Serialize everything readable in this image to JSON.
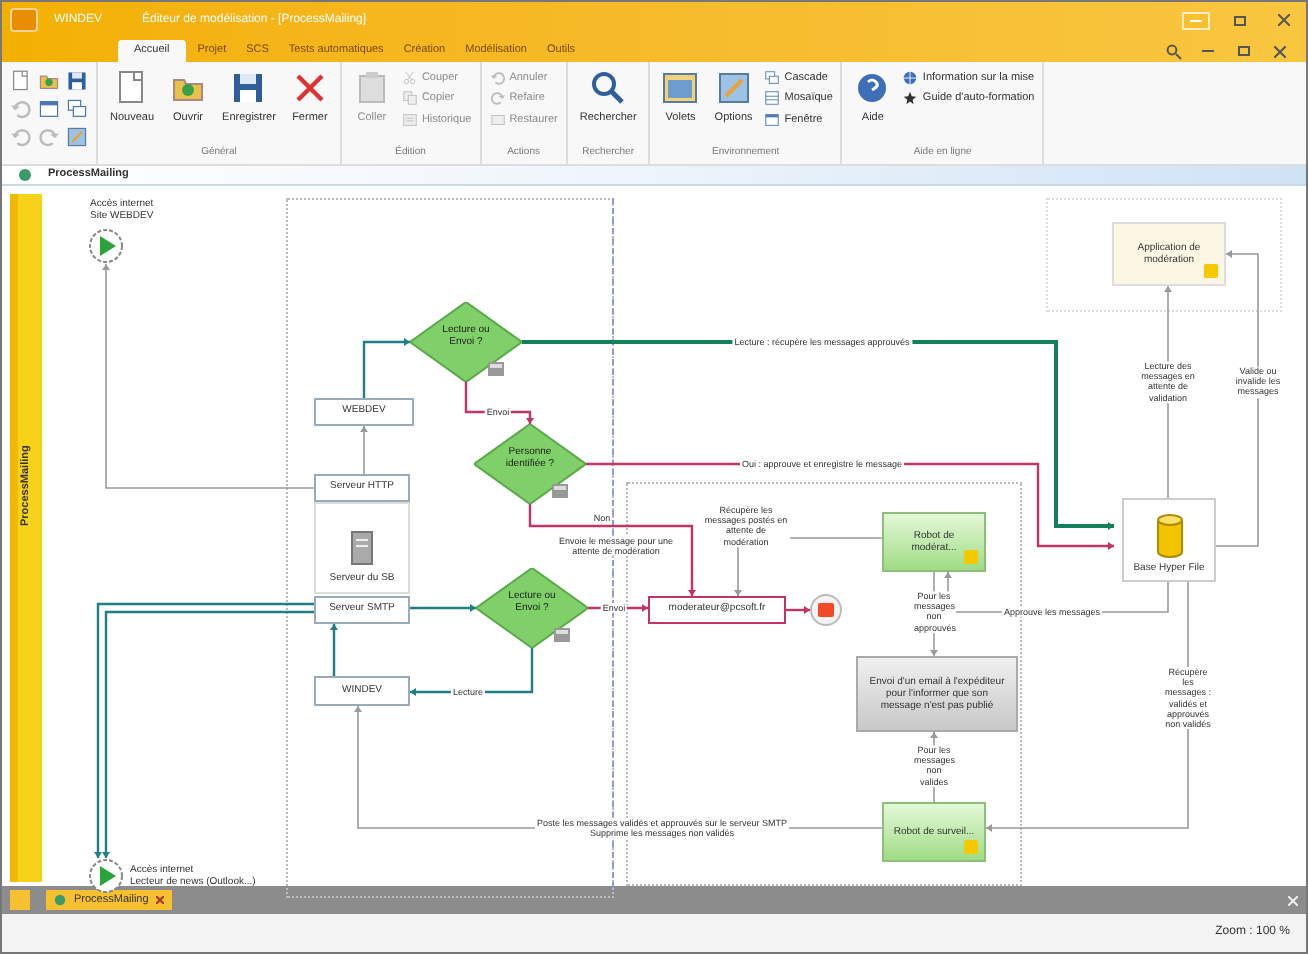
{
  "window": {
    "app": "WINDEV",
    "title": "Éditeur de modélisation - [ProcessMailing]"
  },
  "ribbon_tabs": [
    {
      "label": "Accueil",
      "selected": true
    },
    {
      "label": "Projet",
      "selected": false
    },
    {
      "label": "SCS",
      "selected": false
    },
    {
      "label": "Tests automatiques",
      "selected": false
    },
    {
      "label": "Création",
      "selected": false
    },
    {
      "label": "Modélisation",
      "selected": false
    },
    {
      "label": "Outils",
      "selected": false
    }
  ],
  "ribbon_groups": [
    {
      "label": "Général",
      "items": [
        {
          "label": "Nouveau",
          "kind": "large",
          "disabled": false
        },
        {
          "label": "Ouvrir",
          "kind": "large",
          "disabled": false
        },
        {
          "label": "Enregistrer",
          "kind": "large",
          "disabled": false
        },
        {
          "label": "Fermer",
          "kind": "large",
          "disabled": false
        }
      ]
    },
    {
      "label": "Édition",
      "items": [
        {
          "label": "Coller",
          "kind": "large",
          "disabled": true
        },
        {
          "label": "Couper",
          "kind": "small",
          "disabled": true
        },
        {
          "label": "Copier",
          "kind": "small",
          "disabled": true
        },
        {
          "label": "Historique",
          "kind": "small",
          "disabled": true
        }
      ]
    },
    {
      "label": "Actions",
      "items": [
        {
          "label": "Annuler",
          "kind": "small",
          "disabled": true
        },
        {
          "label": "Refaire",
          "kind": "small",
          "disabled": true
        },
        {
          "label": "Restaurer",
          "kind": "small",
          "disabled": true
        }
      ]
    },
    {
      "label": "Rechercher",
      "items": [
        {
          "label": "Rechercher",
          "kind": "large",
          "disabled": false
        }
      ]
    },
    {
      "label": "Environnement",
      "items": [
        {
          "label": "Volets",
          "kind": "large",
          "disabled": false
        },
        {
          "label": "Options",
          "kind": "large",
          "disabled": false
        },
        {
          "label": "Cascade",
          "kind": "small",
          "disabled": false
        },
        {
          "label": "Mosaïque",
          "kind": "small",
          "disabled": false
        },
        {
          "label": "Fenêtre",
          "kind": "small",
          "disabled": false
        }
      ]
    },
    {
      "label": "Aide en ligne",
      "items": [
        {
          "label": "Aide",
          "kind": "large",
          "disabled": false
        },
        {
          "label": "Information sur la mise",
          "kind": "small",
          "disabled": false
        },
        {
          "label": "Guide d'auto-formation",
          "kind": "small",
          "disabled": false
        }
      ]
    }
  ],
  "document_tab": "ProcessMailing",
  "lane": "ProcessMailing",
  "nodes": [
    {
      "kind": "start",
      "label": "Accès internet\nSite WEBDEV"
    },
    {
      "kind": "gateway",
      "label": "Lecture ou Envoi ?"
    },
    {
      "kind": "system",
      "label": "WEBDEV"
    },
    {
      "kind": "gateway",
      "label": "Personne identifiée ?"
    },
    {
      "kind": "system",
      "label": "Serveur HTTP"
    },
    {
      "kind": "server",
      "label": "Serveur du SB"
    },
    {
      "kind": "system",
      "label": "Serveur SMTP"
    },
    {
      "kind": "gateway",
      "label": "Lecture ou Envoi ?"
    },
    {
      "kind": "system",
      "label": "WINDEV"
    },
    {
      "kind": "message",
      "label": "moderateur@pcsoft.fr"
    },
    {
      "kind": "end"
    },
    {
      "kind": "robot",
      "label": "Robot de modérat..."
    },
    {
      "kind": "manual",
      "label": "Envoi d'un email à l'expéditeur pour l'informer que son message n'est pas publié"
    },
    {
      "kind": "robot",
      "label": "Robot de surveil..."
    },
    {
      "kind": "application",
      "label": "Application de modération"
    },
    {
      "kind": "database",
      "label": "Base Hyper File"
    },
    {
      "kind": "start",
      "label": "Accès internet\nLecteur de news (Outlook...)"
    }
  ],
  "edges": [
    {
      "kind": "teal"
    },
    {
      "kind": "green",
      "label": "Lecture : récupère les messages approuvés"
    },
    {
      "kind": "pink",
      "label": "Envoi"
    },
    {
      "kind": "pink",
      "label": "Oui : approuve et enregistre le message"
    },
    {
      "kind": "pink",
      "label": "Non"
    },
    {
      "kind": "gray"
    },
    {
      "kind": "teal"
    },
    {
      "kind": "teal"
    },
    {
      "kind": "teal"
    },
    {
      "kind": "pink",
      "label": "Envoi"
    },
    {
      "kind": "teal",
      "label": "Lecture"
    },
    {
      "kind": "teal"
    },
    {
      "kind": "gray"
    },
    {
      "kind": "gray",
      "label": "Récupère les messages postés en attente de modération"
    },
    {
      "kind": "gray",
      "label": "Poste les messages validés et approuvés sur le serveur SMTP\nSupprime les messages non validés"
    },
    {
      "kind": "pink"
    },
    {
      "kind": "gray",
      "label": "Pour les messages non approuvés"
    },
    {
      "kind": "gray",
      "label": "Pour les messages non valides"
    },
    {
      "kind": "gray",
      "label": "Approuve les messages"
    },
    {
      "kind": "gray",
      "label": "Lecture des messages en attente de validation"
    },
    {
      "kind": "gray",
      "label": "Récupère les messages : validés et approuvés non validés"
    },
    {
      "kind": "gray",
      "label": "Valide ou invalide les messages"
    }
  ],
  "annotations": [
    "Envoie le message pour une attente de modération"
  ],
  "bottom_tab": "ProcessMailing",
  "status_bar": {
    "zoom": "Zoom : 100 %"
  }
}
